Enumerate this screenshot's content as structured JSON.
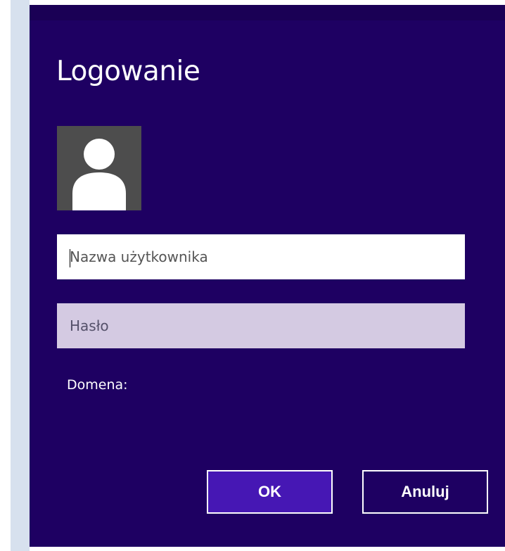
{
  "dialog": {
    "title": "Logowanie",
    "avatar_icon": "user-silhouette-icon",
    "username": {
      "value": "",
      "placeholder": "Nazwa użytkownika"
    },
    "password": {
      "value": "",
      "placeholder": "Hasło"
    },
    "domain_label": "Domena:",
    "buttons": {
      "ok_label": "OK",
      "cancel_label": "Anuluj"
    }
  },
  "colors": {
    "dialog_background": "#1e0062",
    "ok_button_background": "#4617b4",
    "password_field_background": "#d4cae2",
    "text": "#ffffff"
  }
}
